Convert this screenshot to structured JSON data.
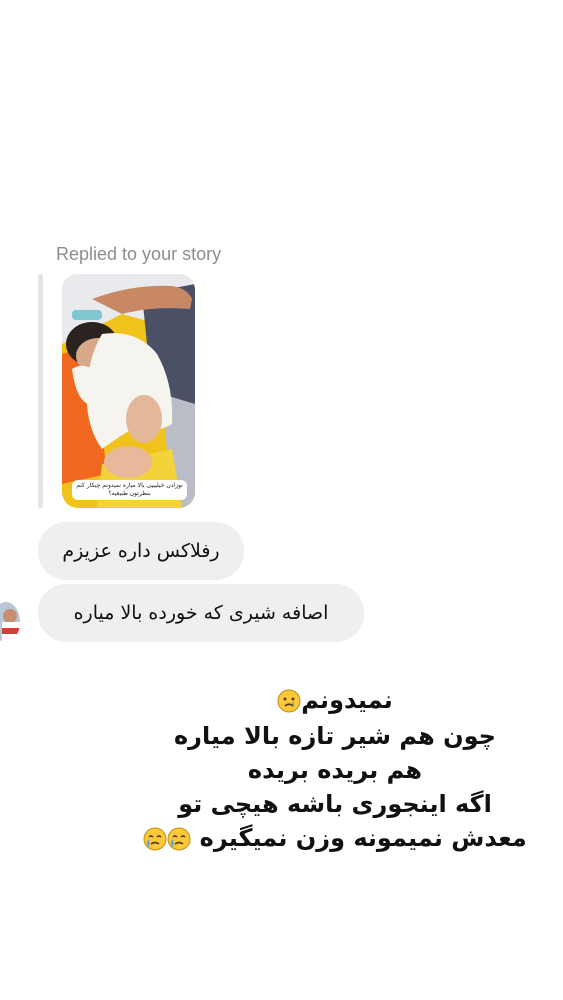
{
  "reply_header": "Replied to your story",
  "story": {
    "caption": "نوزادن خیلیییی بالا میاره نمیدونم چیکار کنم بنظرتون طبیعیه؟"
  },
  "messages": [
    {
      "text": "رفلاکس داره عزیزم"
    },
    {
      "text": "اصافه شیری که خورده بالا میاره"
    }
  ],
  "overlay_text": {
    "line1": "نمیدونم",
    "line2": "چون هم شیر تازه بالا میاره",
    "line3": "هم بریده بریده",
    "line4": "اگه اینجوری باشه هیچی تو",
    "line5": "معدش نمیمونه وزن نمیگیره",
    "emoji_icon": "crying-face-icon"
  }
}
